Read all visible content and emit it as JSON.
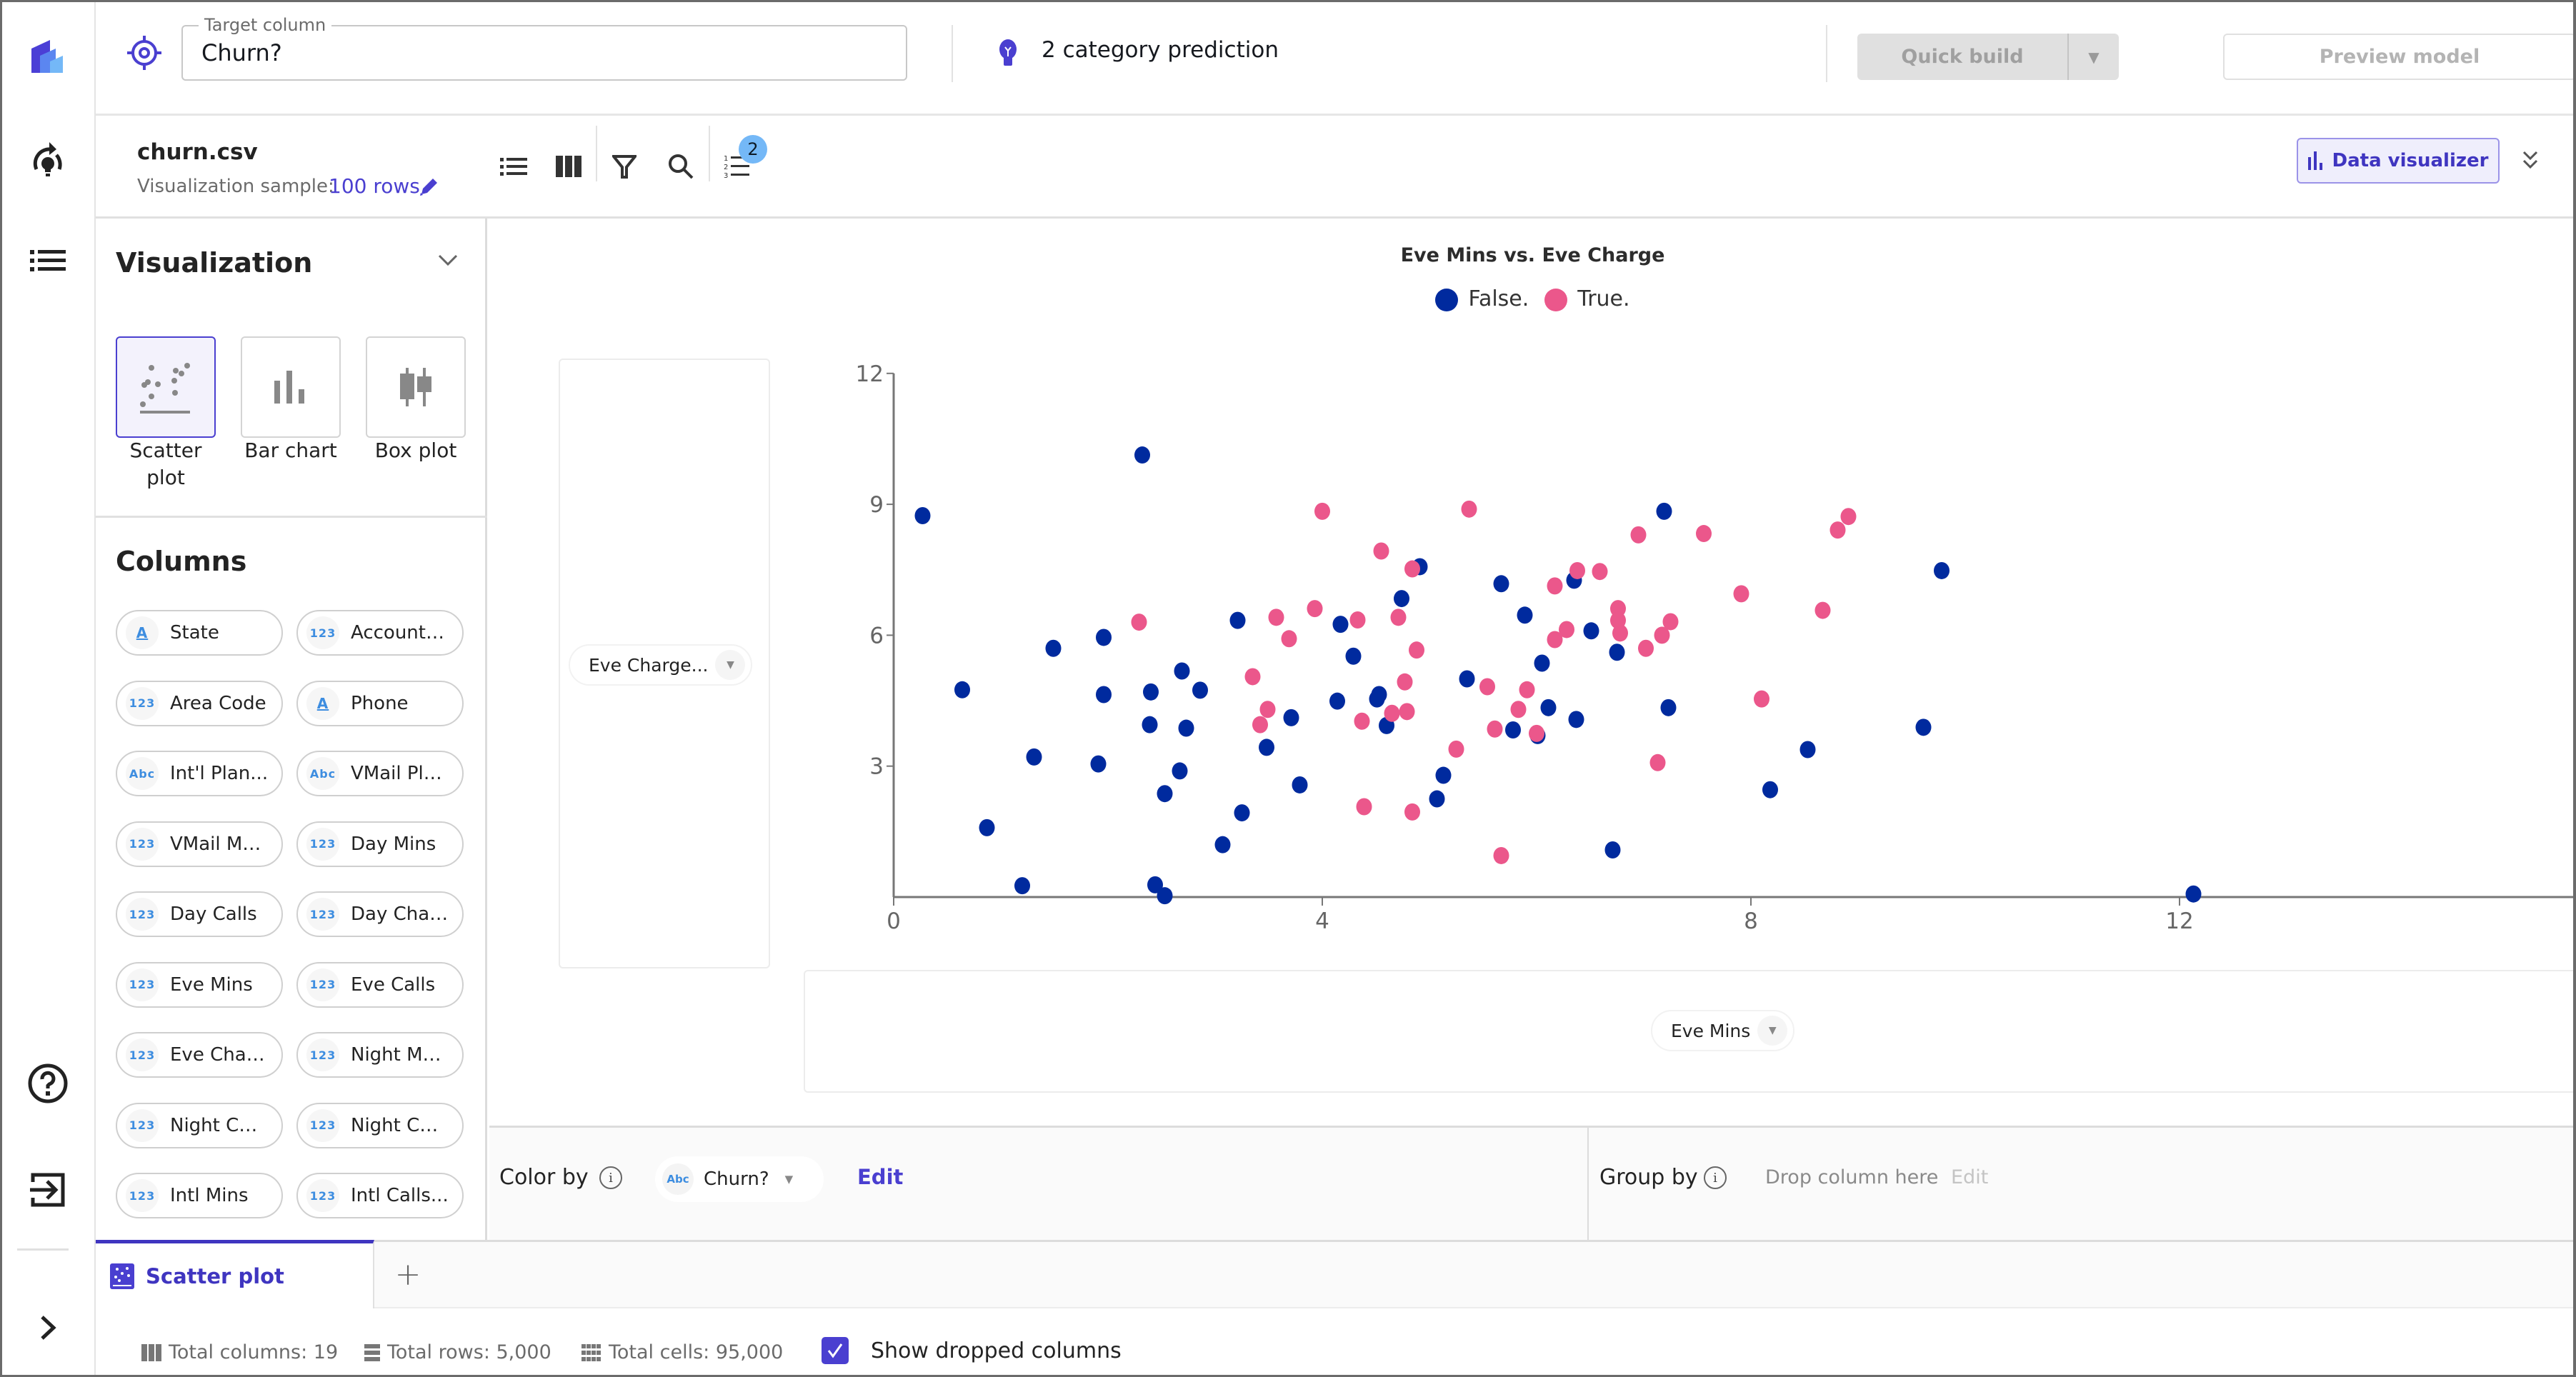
{
  "nav": {
    "items": [
      {
        "name": "app-logo-icon"
      },
      {
        "name": "ml-ops-icon"
      },
      {
        "name": "datasets-list-icon"
      },
      {
        "name": "help-icon"
      },
      {
        "name": "sign-out-icon"
      },
      {
        "name": "expand-nav-icon"
      }
    ]
  },
  "topbar": {
    "target_legend": "Target column",
    "target_value": "Churn?",
    "prediction_type": "2 category prediction",
    "quick_build_label": "Quick build",
    "preview_label": "Preview model"
  },
  "toolbar": {
    "file_name": "churn.csv",
    "sample_label": "Visualization sample:",
    "sample_value": "100 rows",
    "badge_count": "2",
    "data_visualizer_label": "Data visualizer",
    "icons": [
      "list-view-icon",
      "column-view-icon",
      "filter-icon",
      "search-icon",
      "ordered-list-icon"
    ]
  },
  "left_panel": {
    "visualization_title": "Visualization",
    "viz_types": [
      {
        "label": "Scatter plot",
        "line1": "Scatter",
        "line2": "plot",
        "active": true
      },
      {
        "label": "Bar chart",
        "line1": "Bar chart",
        "line2": "",
        "active": false
      },
      {
        "label": "Box plot",
        "line1": "Box plot",
        "line2": "",
        "active": false
      }
    ],
    "columns_title": "Columns",
    "columns": [
      {
        "type": "A",
        "name": "State"
      },
      {
        "type": "123",
        "name": "Account…"
      },
      {
        "type": "123",
        "name": "Area Code"
      },
      {
        "type": "A",
        "name": "Phone"
      },
      {
        "type": "Abc",
        "name": "Int'l Plan..."
      },
      {
        "type": "Abc",
        "name": "VMail Pl…"
      },
      {
        "type": "123",
        "name": "VMail M…"
      },
      {
        "type": "123",
        "name": "Day Mins"
      },
      {
        "type": "123",
        "name": "Day Calls"
      },
      {
        "type": "123",
        "name": "Day Cha…"
      },
      {
        "type": "123",
        "name": "Eve Mins"
      },
      {
        "type": "123",
        "name": "Eve Calls"
      },
      {
        "type": "123",
        "name": "Eve Cha…"
      },
      {
        "type": "123",
        "name": "Night M…"
      },
      {
        "type": "123",
        "name": "Night C…"
      },
      {
        "type": "123",
        "name": "Night C…"
      },
      {
        "type": "123",
        "name": "Intl Mins"
      },
      {
        "type": "123",
        "name": "Intl Calls..."
      }
    ]
  },
  "chart_panel": {
    "y_selector": "Eve Charge...",
    "x_selector": "Eve Mins"
  },
  "color_by": {
    "label": "Color by",
    "chip_type": "Abc",
    "chip_value": "Churn?",
    "edit_label": "Edit",
    "group_by_label": "Group by",
    "group_by_hint": "Drop column here",
    "group_edit_label": "Edit"
  },
  "tabs": {
    "active_label": "Scatter plot",
    "add_label": "+"
  },
  "footer": {
    "total_columns": "Total columns: 19",
    "total_rows": "Total rows: 5,000",
    "total_cells": "Total cells: 95,000",
    "show_dropped_label": "Show dropped columns",
    "show_dropped_checked": true
  },
  "colors": {
    "accent": "#4a3fd0",
    "false_series": "#002a9e",
    "true_series": "#eb578b",
    "type_icon": "#3d8de0"
  },
  "chart_data": {
    "type": "scatter",
    "title": "Eve Mins vs. Eve Charge",
    "xlabel": "Eve Mins",
    "ylabel": "Eve Charge",
    "xlim": [
      0,
      14
    ],
    "ylim": [
      0,
      12
    ],
    "xticks": [
      0,
      4,
      8,
      12
    ],
    "yticks": [
      3,
      6,
      9,
      12
    ],
    "legend_position": "top-center",
    "series": [
      {
        "name": "False.",
        "color": "#002a9e",
        "points": [
          [
            0.27,
            8.74
          ],
          [
            2.32,
            10.13
          ],
          [
            0.64,
            4.75
          ],
          [
            1.49,
            5.7
          ],
          [
            1.96,
            5.95
          ],
          [
            1.96,
            4.64
          ],
          [
            2.4,
            4.7
          ],
          [
            2.69,
            5.18
          ],
          [
            2.86,
            4.74
          ],
          [
            2.39,
            3.95
          ],
          [
            2.73,
            3.87
          ],
          [
            1.31,
            3.21
          ],
          [
            1.91,
            3.05
          ],
          [
            2.67,
            2.89
          ],
          [
            2.53,
            2.37
          ],
          [
            0.87,
            1.59
          ],
          [
            1.2,
            0.26
          ],
          [
            2.44,
            0.28
          ],
          [
            2.53,
            0.03
          ],
          [
            3.07,
            1.2
          ],
          [
            3.25,
            1.93
          ],
          [
            3.48,
            3.43
          ],
          [
            3.79,
            2.57
          ],
          [
            3.71,
            4.11
          ],
          [
            3.21,
            6.34
          ],
          [
            4.91,
            7.57
          ],
          [
            4.74,
            6.84
          ],
          [
            5.67,
            7.18
          ],
          [
            7.19,
            8.84
          ],
          [
            6.35,
            7.26
          ],
          [
            5.89,
            6.46
          ],
          [
            6.51,
            6.1
          ],
          [
            6.75,
            5.61
          ],
          [
            6.05,
            5.36
          ],
          [
            4.17,
            6.25
          ],
          [
            4.29,
            5.52
          ],
          [
            5.35,
            5.0
          ],
          [
            4.14,
            4.49
          ],
          [
            4.53,
            4.64
          ],
          [
            4.51,
            4.54
          ],
          [
            4.6,
            3.93
          ],
          [
            6.11,
            4.34
          ],
          [
            5.78,
            3.83
          ],
          [
            6.01,
            3.7
          ],
          [
            6.37,
            4.07
          ],
          [
            7.23,
            4.34
          ],
          [
            5.13,
            2.79
          ],
          [
            5.07,
            2.25
          ],
          [
            6.71,
            1.08
          ],
          [
            9.78,
            7.48
          ],
          [
            9.61,
            3.89
          ],
          [
            8.53,
            3.38
          ],
          [
            8.18,
            2.46
          ],
          [
            12.13,
            0.07
          ]
        ]
      },
      {
        "name": "True.",
        "color": "#eb578b",
        "points": [
          [
            2.29,
            6.3
          ],
          [
            3.35,
            5.05
          ],
          [
            3.49,
            4.3
          ],
          [
            3.42,
            3.95
          ],
          [
            3.57,
            6.41
          ],
          [
            3.69,
            5.92
          ],
          [
            3.93,
            6.61
          ],
          [
            4.0,
            8.84
          ],
          [
            5.37,
            8.89
          ],
          [
            4.55,
            7.93
          ],
          [
            4.84,
            7.52
          ],
          [
            6.95,
            8.3
          ],
          [
            7.56,
            8.33
          ],
          [
            6.17,
            7.13
          ],
          [
            6.38,
            7.48
          ],
          [
            6.59,
            7.46
          ],
          [
            6.76,
            6.61
          ],
          [
            6.76,
            6.34
          ],
          [
            6.78,
            6.05
          ],
          [
            6.28,
            6.13
          ],
          [
            6.17,
            5.9
          ],
          [
            7.02,
            5.7
          ],
          [
            7.17,
            6.0
          ],
          [
            7.25,
            6.31
          ],
          [
            4.33,
            6.35
          ],
          [
            4.71,
            6.41
          ],
          [
            4.88,
            5.66
          ],
          [
            5.54,
            4.82
          ],
          [
            5.91,
            4.75
          ],
          [
            4.77,
            4.93
          ],
          [
            4.37,
            4.03
          ],
          [
            4.65,
            4.21
          ],
          [
            4.79,
            4.25
          ],
          [
            5.83,
            4.3
          ],
          [
            5.61,
            3.85
          ],
          [
            6.0,
            3.75
          ],
          [
            5.25,
            3.39
          ],
          [
            4.39,
            2.07
          ],
          [
            4.84,
            1.95
          ],
          [
            7.13,
            3.08
          ],
          [
            5.67,
            0.95
          ],
          [
            8.91,
            8.72
          ],
          [
            8.81,
            8.41
          ],
          [
            7.91,
            6.95
          ],
          [
            8.67,
            6.57
          ],
          [
            8.1,
            4.54
          ]
        ]
      }
    ]
  }
}
